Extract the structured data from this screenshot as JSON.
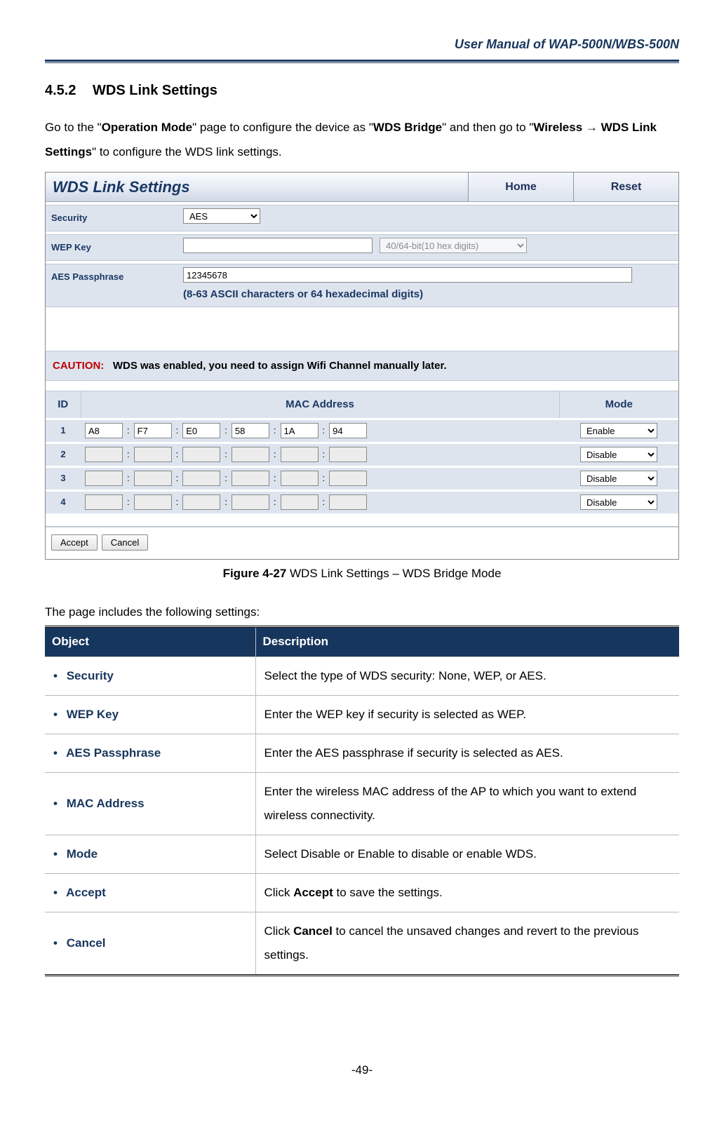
{
  "header": {
    "doc_title": "User Manual of WAP-500N/WBS-500N"
  },
  "section": {
    "number": "4.5.2",
    "title": "WDS Link Settings"
  },
  "intro": {
    "p1a": "Go to the \"",
    "p1b": "Operation Mode",
    "p1c": "\" page to configure the device as \"",
    "p1d": "WDS Bridge",
    "p1e": "\" and then go to \"",
    "p1f": "Wireless ",
    "arrow": "→",
    "p1g": " WDS Link Settings",
    "p1h": "\" to configure the WDS link settings."
  },
  "panel": {
    "title": "WDS Link Settings",
    "home": "Home",
    "reset": "Reset",
    "security_label": "Security",
    "security_value": "AES",
    "wep_label": "WEP Key",
    "wep_value": "",
    "wep_bits": "40/64-bit(10 hex digits)",
    "aes_label": "AES Passphrase",
    "aes_value": "12345678",
    "aes_note": "(8-63 ASCII characters or 64 hexadecimal digits)",
    "caution_label": "CAUTION:",
    "caution_text": "WDS was enabled, you need to assign Wifi Channel manually later.",
    "mac_headers": {
      "id": "ID",
      "mac": "MAC Address",
      "mode": "Mode"
    },
    "mac_rows": [
      {
        "id": "1",
        "oct": [
          "A8",
          "F7",
          "E0",
          "58",
          "1A",
          "94"
        ],
        "mode": "Enable",
        "enabled": true
      },
      {
        "id": "2",
        "oct": [
          "",
          "",
          "",
          "",
          "",
          ""
        ],
        "mode": "Disable",
        "enabled": false
      },
      {
        "id": "3",
        "oct": [
          "",
          "",
          "",
          "",
          "",
          ""
        ],
        "mode": "Disable",
        "enabled": false
      },
      {
        "id": "4",
        "oct": [
          "",
          "",
          "",
          "",
          "",
          ""
        ],
        "mode": "Disable",
        "enabled": false
      }
    ],
    "accept": "Accept",
    "cancel": "Cancel"
  },
  "figure": {
    "label": "Figure 4-27",
    "text": " WDS Link Settings – WDS Bridge Mode"
  },
  "table_intro": "The page includes the following settings:",
  "desc_table": {
    "head": {
      "object": "Object",
      "description": "Description"
    },
    "rows": [
      {
        "obj": "Security",
        "desc_pre": "Select the type of WDS security: None, WEP, or AES.",
        "desc_bold": "",
        "desc_post": ""
      },
      {
        "obj": "WEP Key",
        "desc_pre": "Enter the WEP key if security is selected as WEP.",
        "desc_bold": "",
        "desc_post": ""
      },
      {
        "obj": "AES Passphrase",
        "desc_pre": "Enter the AES passphrase if security is selected as AES.",
        "desc_bold": "",
        "desc_post": ""
      },
      {
        "obj": "MAC Address",
        "desc_pre": "Enter the wireless MAC address of the AP to which you want to extend wireless connectivity.",
        "desc_bold": "",
        "desc_post": ""
      },
      {
        "obj": "Mode",
        "desc_pre": "Select Disable or Enable to disable or enable WDS.",
        "desc_bold": "",
        "desc_post": ""
      },
      {
        "obj": "Accept",
        "desc_pre": "Click ",
        "desc_bold": "Accept",
        "desc_post": " to save the settings."
      },
      {
        "obj": "Cancel",
        "desc_pre": "Click ",
        "desc_bold": "Cancel",
        "desc_post": " to cancel the unsaved changes and revert to the previous settings."
      }
    ]
  },
  "page_number": "-49-"
}
